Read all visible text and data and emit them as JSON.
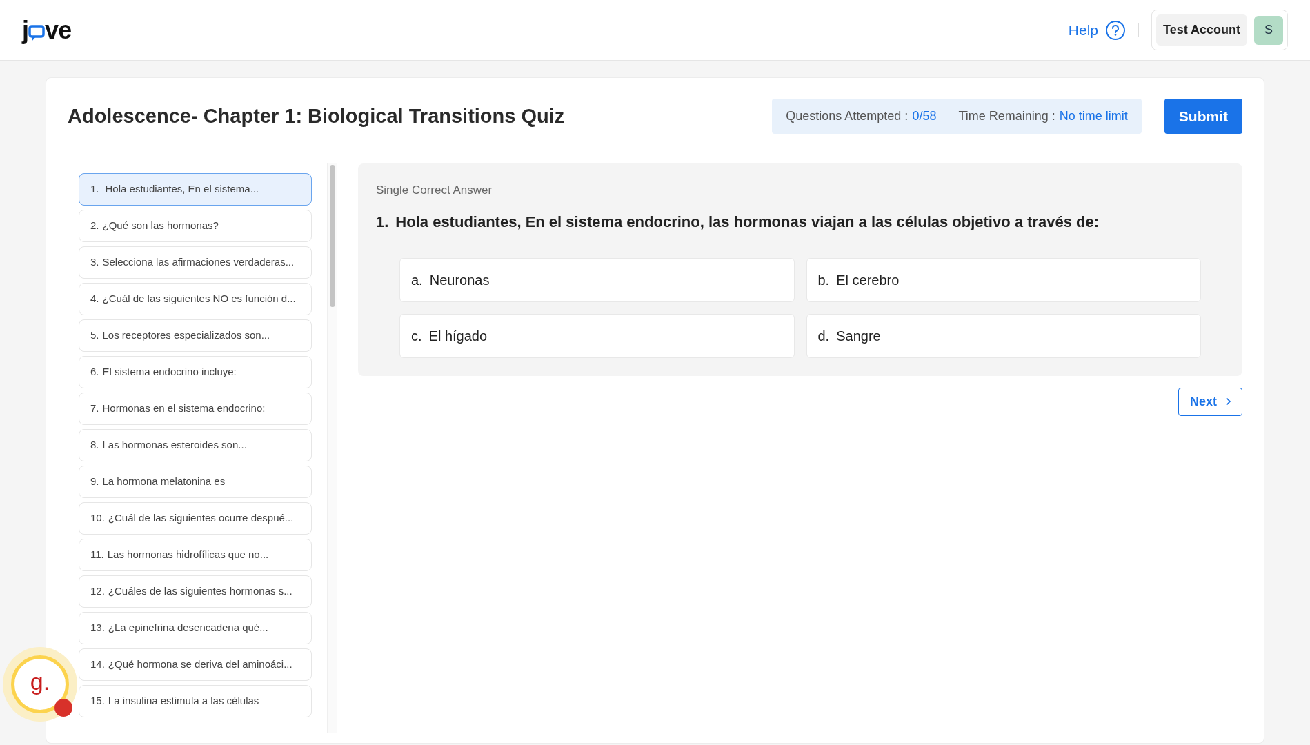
{
  "header": {
    "logo": {
      "before": "j",
      "after": "ve"
    },
    "help": "Help",
    "account": {
      "name": "Test Account",
      "initial": "S"
    }
  },
  "quiz": {
    "title": "Adolescence- Chapter 1: Biological Transitions Quiz",
    "attempted_label": "Questions Attempted :",
    "attempted_value": "0/58",
    "time_label": "Time Remaining :",
    "time_value": "No time limit",
    "submit": "Submit"
  },
  "questions": [
    {
      "number": "1.",
      "text": "Hola estudiantes, En el sistema...",
      "selected": true
    },
    {
      "number": "2.",
      "text": "¿Qué son las hormonas?",
      "selected": false
    },
    {
      "number": "3.",
      "text": "Selecciona las afirmaciones verdaderas...",
      "selected": false
    },
    {
      "number": "4.",
      "text": "¿Cuál de las siguientes NO es función d...",
      "selected": false
    },
    {
      "number": "5.",
      "text": "Los receptores especializados son...",
      "selected": false
    },
    {
      "number": "6.",
      "text": "El sistema endocrino incluye:",
      "selected": false
    },
    {
      "number": "7.",
      "text": "Hormonas en el sistema endocrino:",
      "selected": false
    },
    {
      "number": "8.",
      "text": "Las hormonas esteroides son...",
      "selected": false
    },
    {
      "number": "9.",
      "text": "La hormona melatonina es",
      "selected": false
    },
    {
      "number": "10.",
      "text": "¿Cuál de las siguientes ocurre despué...",
      "selected": false
    },
    {
      "number": "11.",
      "text": "Las hormonas hidrofílicas que no...",
      "selected": false
    },
    {
      "number": "12.",
      "text": "¿Cuáles de las siguientes hormonas s...",
      "selected": false
    },
    {
      "number": "13.",
      "text": "¿La epinefrina desencadena qué...",
      "selected": false
    },
    {
      "number": "14.",
      "text": "¿Qué hormona se deriva del aminoáci...",
      "selected": false
    },
    {
      "number": "15.",
      "text": "La insulina estimula a las células",
      "selected": false
    }
  ],
  "current": {
    "type_label": "Single Correct Answer",
    "number": "1.",
    "text": "Hola estudiantes, En el sistema endocrino, las hormonas viajan a las células objetivo a través de:",
    "options": [
      {
        "letter": "a.",
        "text": "Neuronas"
      },
      {
        "letter": "b.",
        "text": "El cerebro"
      },
      {
        "letter": "c.",
        "text": "El hígado"
      },
      {
        "letter": "d.",
        "text": "Sangre"
      }
    ],
    "next": "Next"
  },
  "widget": {
    "letter": "g."
  }
}
